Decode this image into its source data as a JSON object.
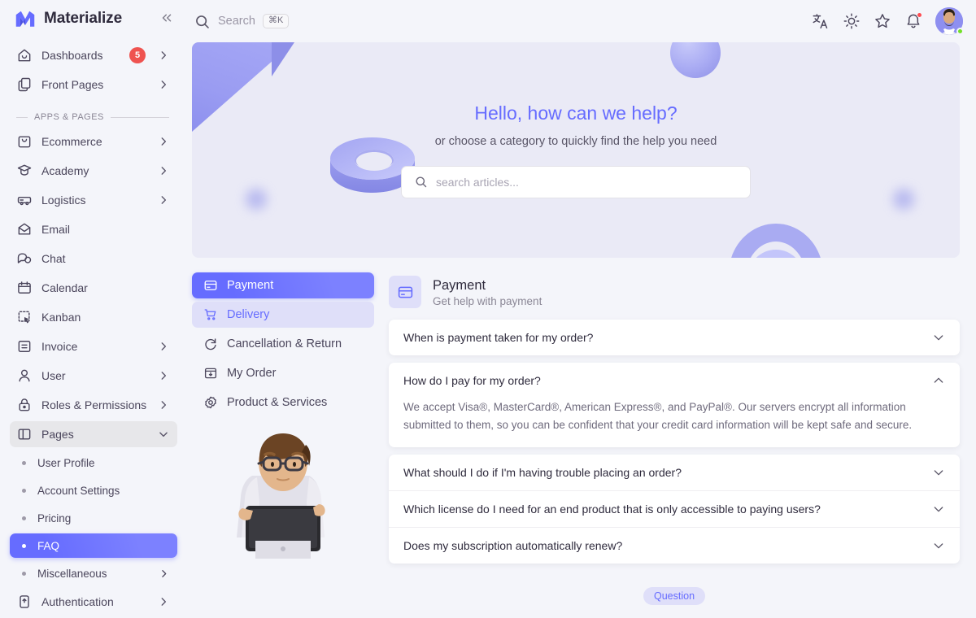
{
  "brand": {
    "name": "Materialize",
    "logo_icon": "materialize-logo",
    "collapse_icon": "chevron-double-left-icon"
  },
  "sidebar": {
    "top_items": [
      {
        "label": "Dashboards",
        "icon": "home-icon",
        "badge": "5",
        "chevron": true
      },
      {
        "label": "Front Pages",
        "icon": "layers-icon",
        "badge": "",
        "chevron": true
      }
    ],
    "section_label": "APPS & PAGES",
    "items": [
      {
        "label": "Ecommerce",
        "icon": "shopping-bag-icon",
        "chevron": true
      },
      {
        "label": "Academy",
        "icon": "graduation-cap-icon",
        "chevron": true
      },
      {
        "label": "Logistics",
        "icon": "truck-icon",
        "chevron": true
      },
      {
        "label": "Email",
        "icon": "mail-icon",
        "chevron": false
      },
      {
        "label": "Chat",
        "icon": "chat-bubble-icon",
        "chevron": false
      },
      {
        "label": "Calendar",
        "icon": "calendar-icon",
        "chevron": false
      },
      {
        "label": "Kanban",
        "icon": "kanban-icon",
        "chevron": false
      },
      {
        "label": "Invoice",
        "icon": "invoice-icon",
        "chevron": true
      },
      {
        "label": "User",
        "icon": "user-icon",
        "chevron": true
      },
      {
        "label": "Roles & Permissions",
        "icon": "lock-icon",
        "chevron": true
      }
    ],
    "pages_group": {
      "label": "Pages",
      "icon": "pages-panel-icon",
      "chevron": "chevron-down-icon",
      "expanded": true
    },
    "pages_children": [
      {
        "label": "User Profile",
        "chevron": false,
        "active": false
      },
      {
        "label": "Account Settings",
        "chevron": false,
        "active": false
      },
      {
        "label": "Pricing",
        "chevron": false,
        "active": false
      },
      {
        "label": "FAQ",
        "chevron": false,
        "active": true
      },
      {
        "label": "Miscellaneous",
        "chevron": true,
        "active": false
      }
    ],
    "bottom_item": {
      "label": "Authentication",
      "icon": "authentication-icon",
      "chevron": true
    }
  },
  "topbar": {
    "search_placeholder": "Search",
    "search_shortcut": "⌘K",
    "search_icon": "search-icon",
    "icons": [
      "translate-icon",
      "sun-icon",
      "star-icon",
      "bell-icon"
    ],
    "avatar": "user-avatar"
  },
  "hero": {
    "title": "Hello, how can we help?",
    "subtitle": "or choose a category to quickly find the help you need",
    "search_placeholder": "search articles...",
    "search_icon": "search-icon",
    "bg_color": "#EAEAF6",
    "accent_color": "#666CFF"
  },
  "categories": [
    {
      "label": "Payment",
      "icon": "credit-card-icon",
      "state": "active"
    },
    {
      "label": "Delivery",
      "icon": "cart-icon",
      "state": "hovered"
    },
    {
      "label": "Cancellation & Return",
      "icon": "refresh-icon",
      "state": "default"
    },
    {
      "label": "My Order",
      "icon": "box-download-icon",
      "state": "default"
    },
    {
      "label": "Product & Services",
      "icon": "gear-icon",
      "state": "default"
    }
  ],
  "illustration": "person-with-tablet-illustration",
  "panel": {
    "icon": "credit-card-icon",
    "title": "Payment",
    "subtitle": "Get help with payment"
  },
  "faqs": [
    {
      "question": "When is payment taken for my order?",
      "answer": "",
      "expanded": false,
      "chevron": "chevron-down-icon"
    },
    {
      "question": "How do I pay for my order?",
      "answer": "We accept Visa®, MasterCard®, American Express®, and PayPal®. Our servers encrypt all information submitted to them, so you can be confident that your credit card information will be kept safe and secure.",
      "expanded": true,
      "chevron": "chevron-up-icon"
    },
    {
      "question": "What should I do if I'm having trouble placing an order?",
      "answer": "",
      "expanded": false,
      "chevron": "chevron-down-icon"
    },
    {
      "question": "Which license do I need for an end product that is only accessible to paying users?",
      "answer": "",
      "expanded": false,
      "chevron": "chevron-down-icon"
    },
    {
      "question": "Does my subscription automatically renew?",
      "answer": "",
      "expanded": false,
      "chevron": "chevron-down-icon"
    }
  ],
  "footer": {
    "chip_label": "Question"
  }
}
